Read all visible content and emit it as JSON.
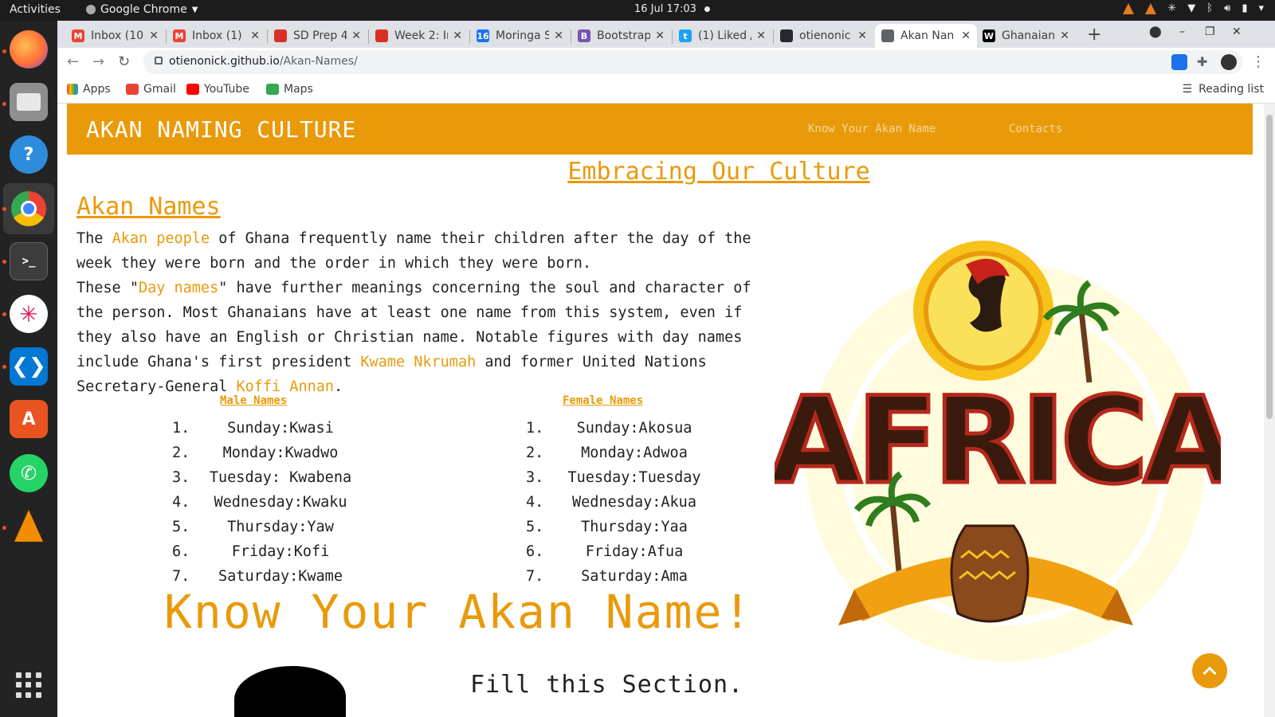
{
  "system": {
    "activities": "Activities",
    "app_name": "Google Chrome",
    "clock": "16 Jul  17:03"
  },
  "dock": {
    "icons": [
      "firefox-icon",
      "files-icon",
      "help-icon",
      "chrome-icon",
      "terminal-icon",
      "slack-icon",
      "vscode-icon",
      "software-icon",
      "whatsapp-icon",
      "vlc-icon"
    ]
  },
  "browser": {
    "tabs": [
      {
        "title": "Inbox (10",
        "favicon": "M",
        "color": "#ea4335"
      },
      {
        "title": "Inbox (1) -",
        "favicon": "M",
        "color": "#ea4335"
      },
      {
        "title": "SD Prep 4",
        "favicon": "",
        "color": "#d93025"
      },
      {
        "title": "Week 2: In",
        "favicon": "",
        "color": "#d93025"
      },
      {
        "title": "Moringa S",
        "favicon": "16",
        "color": "#1a73e8"
      },
      {
        "title": "Bootstrap",
        "favicon": "B",
        "color": "#7952b3"
      },
      {
        "title": "(1) Liked /",
        "favicon": "t",
        "color": "#1da1f2"
      },
      {
        "title": "otienonic",
        "favicon": "",
        "color": "#24292e"
      },
      {
        "title": "Akan Nan",
        "favicon": "",
        "color": "#5f6368"
      },
      {
        "title": "Ghanaian",
        "favicon": "W",
        "color": "#000000"
      }
    ],
    "url_host": "otienonick.github.io",
    "url_path": "/Akan-Names/",
    "bookmarks": [
      "Apps",
      "Gmail",
      "YouTube",
      "Maps"
    ],
    "reading_list": "Reading list"
  },
  "page": {
    "brand": "AKAN NAMING CULTURE",
    "nav_links": [
      "Know Your Akan Name",
      "Contacts"
    ],
    "heading_embrace": "Embracing Our Culture",
    "heading_akan": "Akan Names",
    "para": {
      "t1": "The ",
      "link1": "Akan people",
      "t2": " of Ghana frequently name their children after the day of the week they were born and the order in which they were born.",
      "t3": "These \"",
      "link2": "Day names",
      "t4": "\" have further meanings concerning the soul and character of the person. Most Ghanaians have at least one name from this system, even if they also have an English or Christian name. Notable figures with day names include Ghana's first president ",
      "link3": "Kwame Nkrumah",
      "t5": " and former United Nations Secretary-General ",
      "link4": "Koffi Annan",
      "t6": "."
    },
    "male_heading": "Male Names",
    "female_heading": "Female Names",
    "male_names": [
      "Sunday:Kwasi",
      "Monday:Kwadwo",
      "Tuesday: Kwabena",
      "Wednesday:Kwaku",
      "Thursday:Yaw",
      "Friday:Kofi",
      "Saturday:Kwame"
    ],
    "female_names": [
      "Sunday:Akosua",
      "Monday:Adwoa",
      "Tuesday:Tuesday",
      "Wednesday:Akua",
      "Thursday:Yaa",
      "Friday:Afua",
      "Saturday:Ama"
    ],
    "know_title": "Know Your Akan Name!",
    "fill_section": "Fill this Section.",
    "art_text": "AFRICA"
  },
  "colors": {
    "accent": "#e99a0a",
    "art_red": "#b5281c",
    "art_dark": "#3a1a0c"
  }
}
